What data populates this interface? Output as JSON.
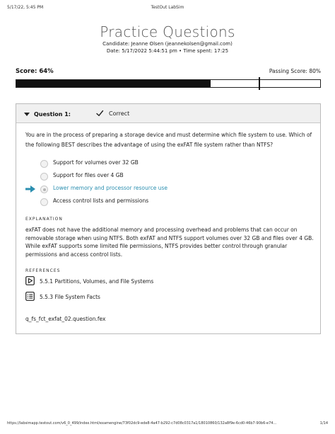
{
  "print_header": {
    "date": "5/17/22, 5:45 PM",
    "title": "TestOut LabSim"
  },
  "page": {
    "title": "Practice Questions",
    "candidate": "Candidate: Jeanne Olsen  (jeannekolsen@gmail.com)",
    "date_time": "Date: 5/17/2022 5:44:51 pm • Time spent: 17:25"
  },
  "score": {
    "label": "Score: 64%",
    "value_percent": 64,
    "passing_label": "Passing Score: 80%",
    "passing_percent": 80
  },
  "question": {
    "number": "Question 1:",
    "status": "Correct",
    "status_icon": "checkmark-icon",
    "text": "You are in the process of preparing a storage device and must determine which file system to use. Which of the following BEST describes the advantage of using the exFAT file system rather than NTFS?",
    "answers": [
      {
        "label": "Support for volumes over 32 GB",
        "selected": false,
        "correct": false
      },
      {
        "label": "Support for files over 4 GB",
        "selected": false,
        "correct": false
      },
      {
        "label": "Lower memory and processor resource use",
        "selected": true,
        "correct": true
      },
      {
        "label": "Access control lists and permissions",
        "selected": false,
        "correct": false
      }
    ],
    "explanation_heading": "EXPLANATION",
    "explanation": "exFAT does not have the additional memory and processing overhead and problems that can occur on removable storage when using NTFS. Both exFAT and NTFS support volumes over 32 GB and files over 4 GB. While exFAT supports some limited file permissions, NTFS provides better control through granular permissions and access control lists.",
    "references_heading": "REFERENCES",
    "references": [
      {
        "icon": "video-play-icon",
        "label": "5.5.1 Partitions, Volumes, and File Systems"
      },
      {
        "icon": "document-list-icon",
        "label": "5.5.3 File System Facts"
      }
    ],
    "file": "q_fs_fct_exfat_02.question.fex"
  },
  "print_footer": {
    "url": "https://labsimapp.testout.com/v6_0_499/index.html/examengine/73f02dc9-ede8-4a47-b292-c7d08c0317a1/18010860/132a8f9e-6cd0-46b7-90b6-e74…",
    "page": "1/14"
  }
}
